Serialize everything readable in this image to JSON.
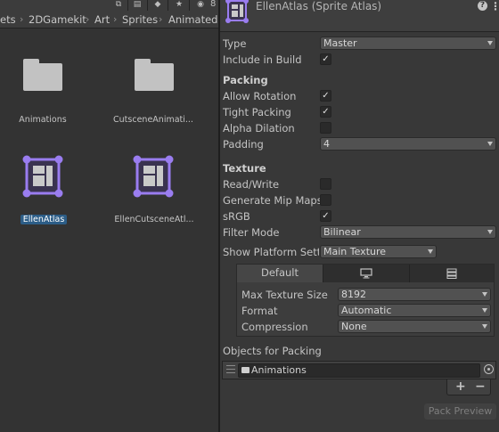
{
  "project": {
    "eye_count": "8",
    "breadcrumb": [
      "ets",
      "2DGamekit",
      "Art",
      "Sprites",
      "AnimatedS"
    ],
    "assets": [
      {
        "name": "Animations",
        "type": "folder"
      },
      {
        "name": "CutsceneAnimati...",
        "type": "folder"
      },
      {
        "name": "EllenAtlas",
        "type": "sprite-atlas",
        "selected": true
      },
      {
        "name": "EllenCutsceneAtl...",
        "type": "sprite-atlas"
      }
    ]
  },
  "inspector": {
    "title": "EllenAtlas (Sprite Atlas)",
    "type": {
      "label": "Type",
      "value": "Master"
    },
    "include_in_build": {
      "label": "Include in Build",
      "checked": true
    },
    "packing": {
      "header": "Packing",
      "allow_rotation": {
        "label": "Allow Rotation",
        "checked": true
      },
      "tight_packing": {
        "label": "Tight Packing",
        "checked": true
      },
      "alpha_dilation": {
        "label": "Alpha Dilation",
        "checked": false
      },
      "padding": {
        "label": "Padding",
        "value": "4"
      }
    },
    "texture": {
      "header": "Texture",
      "read_write": {
        "label": "Read/Write",
        "checked": false
      },
      "generate_mip_maps": {
        "label": "Generate Mip Maps",
        "checked": false
      },
      "srgb": {
        "label": "sRGB",
        "checked": true
      },
      "filter_mode": {
        "label": "Filter Mode",
        "value": "Bilinear"
      }
    },
    "show_platform_settings": {
      "label": "Show Platform Setti",
      "value": "Main Texture"
    },
    "platform_tabs": {
      "default_label": "Default",
      "max_texture_size": {
        "label": "Max Texture Size",
        "value": "8192"
      },
      "format": {
        "label": "Format",
        "value": "Automatic"
      },
      "compression": {
        "label": "Compression",
        "value": "None"
      }
    },
    "objects_for_packing": {
      "header": "Objects for Packing",
      "items": [
        "Animations"
      ]
    },
    "add_label": "+",
    "remove_label": "−",
    "pack_preview_label": "Pack Preview"
  },
  "colors": {
    "accent": "#9a7df0",
    "selection": "#2c5d87"
  }
}
